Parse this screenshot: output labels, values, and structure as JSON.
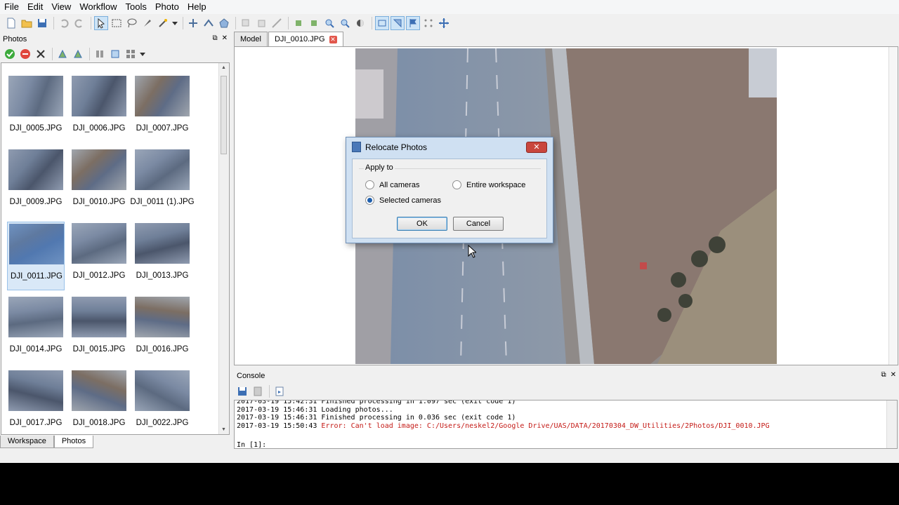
{
  "menu": [
    "File",
    "Edit",
    "View",
    "Workflow",
    "Tools",
    "Photo",
    "Help"
  ],
  "photos_panel": {
    "title": "Photos",
    "items": [
      {
        "label": "DJI_0005.JPG",
        "selected": false
      },
      {
        "label": "DJI_0006.JPG",
        "selected": false
      },
      {
        "label": "DJI_0007.JPG",
        "selected": false
      },
      {
        "label": "DJI_0009.JPG",
        "selected": false
      },
      {
        "label": "DJI_0010.JPG",
        "selected": false
      },
      {
        "label": "DJI_0011 (1).JPG",
        "selected": false
      },
      {
        "label": "DJI_0011.JPG",
        "selected": true
      },
      {
        "label": "DJI_0012.JPG",
        "selected": false
      },
      {
        "label": "DJI_0013.JPG",
        "selected": false
      },
      {
        "label": "DJI_0014.JPG",
        "selected": false
      },
      {
        "label": "DJI_0015.JPG",
        "selected": false
      },
      {
        "label": "DJI_0016.JPG",
        "selected": false
      },
      {
        "label": "DJI_0017.JPG",
        "selected": false
      },
      {
        "label": "DJI_0018.JPG",
        "selected": false
      },
      {
        "label": "DJI_0022.JPG",
        "selected": false
      }
    ]
  },
  "bottom_tabs": {
    "workspace": "Workspace",
    "photos": "Photos"
  },
  "doc_tabs": {
    "model": "Model",
    "photo": "DJI_0010.JPG"
  },
  "console": {
    "title": "Console",
    "lines": [
      {
        "text": "2017-03-19 15:42:31 Finished processing in 1.097 sec (exit code 1)",
        "error": false
      },
      {
        "text": "2017-03-19 15:46:31 Loading photos...",
        "error": false
      },
      {
        "text": "2017-03-19 15:46:31 Finished processing in 0.036 sec (exit code 1)",
        "error": false
      },
      {
        "prefix": "2017-03-19 15:50:43 ",
        "text": "Error: Can't load image: C:/Users/neskel2/Google Drive/UAS/DATA/20170304_DW_Utilities/2Photos/DJI_0010.JPG",
        "error": true
      }
    ],
    "prompt": "In [1]:"
  },
  "dialog": {
    "title": "Relocate Photos",
    "group_label": "Apply to",
    "options": {
      "all": "All cameras",
      "entire": "Entire workspace",
      "selected": "Selected cameras"
    },
    "selected_option": "selected",
    "ok": "OK",
    "cancel": "Cancel"
  }
}
